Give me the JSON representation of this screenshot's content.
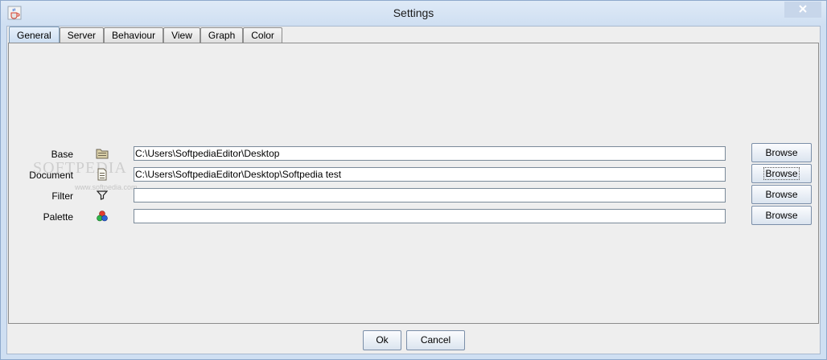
{
  "window": {
    "title": "Settings",
    "app_icon": "java-cup-icon",
    "close_icon": "close-icon"
  },
  "tabs": [
    {
      "label": "General",
      "active": true
    },
    {
      "label": "Server",
      "active": false
    },
    {
      "label": "Behaviour",
      "active": false
    },
    {
      "label": "View",
      "active": false
    },
    {
      "label": "Graph",
      "active": false
    },
    {
      "label": "Color",
      "active": false
    }
  ],
  "general": {
    "rows": [
      {
        "label": "Base",
        "icon": "folder-icon",
        "value": "C:\\Users\\SoftpediaEditor\\Desktop",
        "button": "Browse"
      },
      {
        "label": "Document",
        "icon": "document-icon",
        "value": "C:\\Users\\SoftpediaEditor\\Desktop\\Softpedia test",
        "button": "Browse"
      },
      {
        "label": "Filter",
        "icon": "filter-icon",
        "value": "",
        "button": "Browse"
      },
      {
        "label": "Palette",
        "icon": "palette-icon",
        "value": "",
        "button": "Browse"
      }
    ]
  },
  "footer": {
    "ok_label": "Ok",
    "cancel_label": "Cancel"
  },
  "watermark": {
    "text": "SOFTPEDIA",
    "url": "www.softpedia.com"
  }
}
